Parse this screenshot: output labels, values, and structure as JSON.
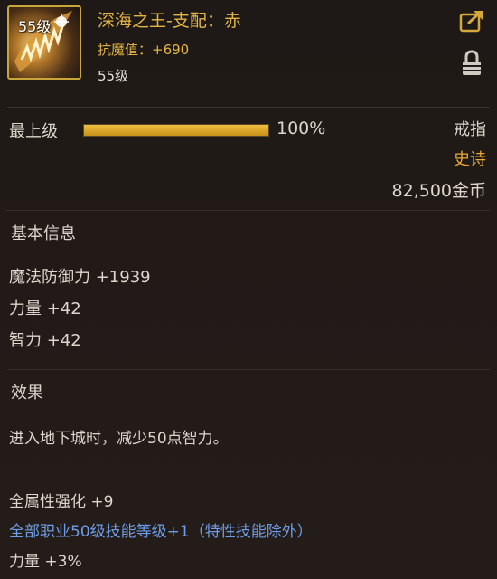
{
  "item": {
    "level_badge": "55级",
    "name": "深海之王-支配：赤",
    "magic_resist": "抗魔值：+690",
    "level": "55级"
  },
  "grade": {
    "label": "最上级",
    "percent": 100,
    "percent_text": "100%"
  },
  "info": {
    "type": "戒指",
    "rarity": "史诗",
    "price": "82,500金币"
  },
  "basic": {
    "title": "基本信息",
    "stats": [
      "魔法防御力 +1939",
      "力量 +42",
      "智力 +42"
    ]
  },
  "effects": {
    "title": "效果",
    "dungeon_penalty": "进入地下城时，减少50点智力。",
    "all_element": "全属性强化 +9",
    "skill_level": "全部职业50级技能等级+1（特性技能除外）",
    "strength_pct": "力量 +3%"
  },
  "colors": {
    "gold": "#e3b545",
    "epic": "#e8a83a",
    "skill_blue": "#6f9ee8"
  },
  "icons": [
    "item-ring-icon",
    "share-icon",
    "lock-icon"
  ]
}
